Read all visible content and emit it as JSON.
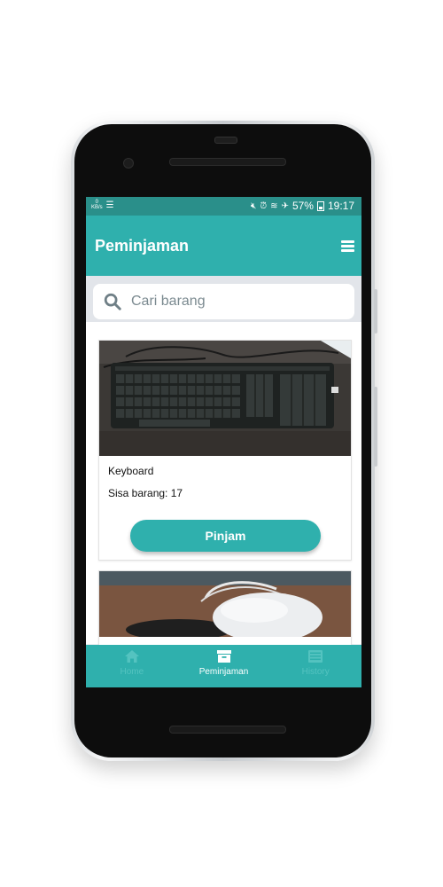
{
  "status_bar": {
    "speed_value": "0",
    "speed_unit": "KB/s",
    "battery": "57%",
    "time": "19:17"
  },
  "app_bar": {
    "title": "Peminjaman"
  },
  "search": {
    "placeholder": "Cari barang"
  },
  "items": [
    {
      "name": "Keyboard",
      "stock_label": "Sisa barang: 17",
      "button_label": "Pinjam"
    },
    {
      "name": "",
      "stock_label": "",
      "button_label": ""
    }
  ],
  "bottom_nav": {
    "items": [
      {
        "label": "Home",
        "icon": "home-icon",
        "active": false
      },
      {
        "label": "Peminjaman",
        "icon": "archive-icon",
        "active": true
      },
      {
        "label": "History",
        "icon": "list-icon",
        "active": false
      }
    ]
  },
  "colors": {
    "primary": "#2fb0ad",
    "status_bar": "#2a8f8a",
    "nav_inactive": "#54c3c0"
  }
}
